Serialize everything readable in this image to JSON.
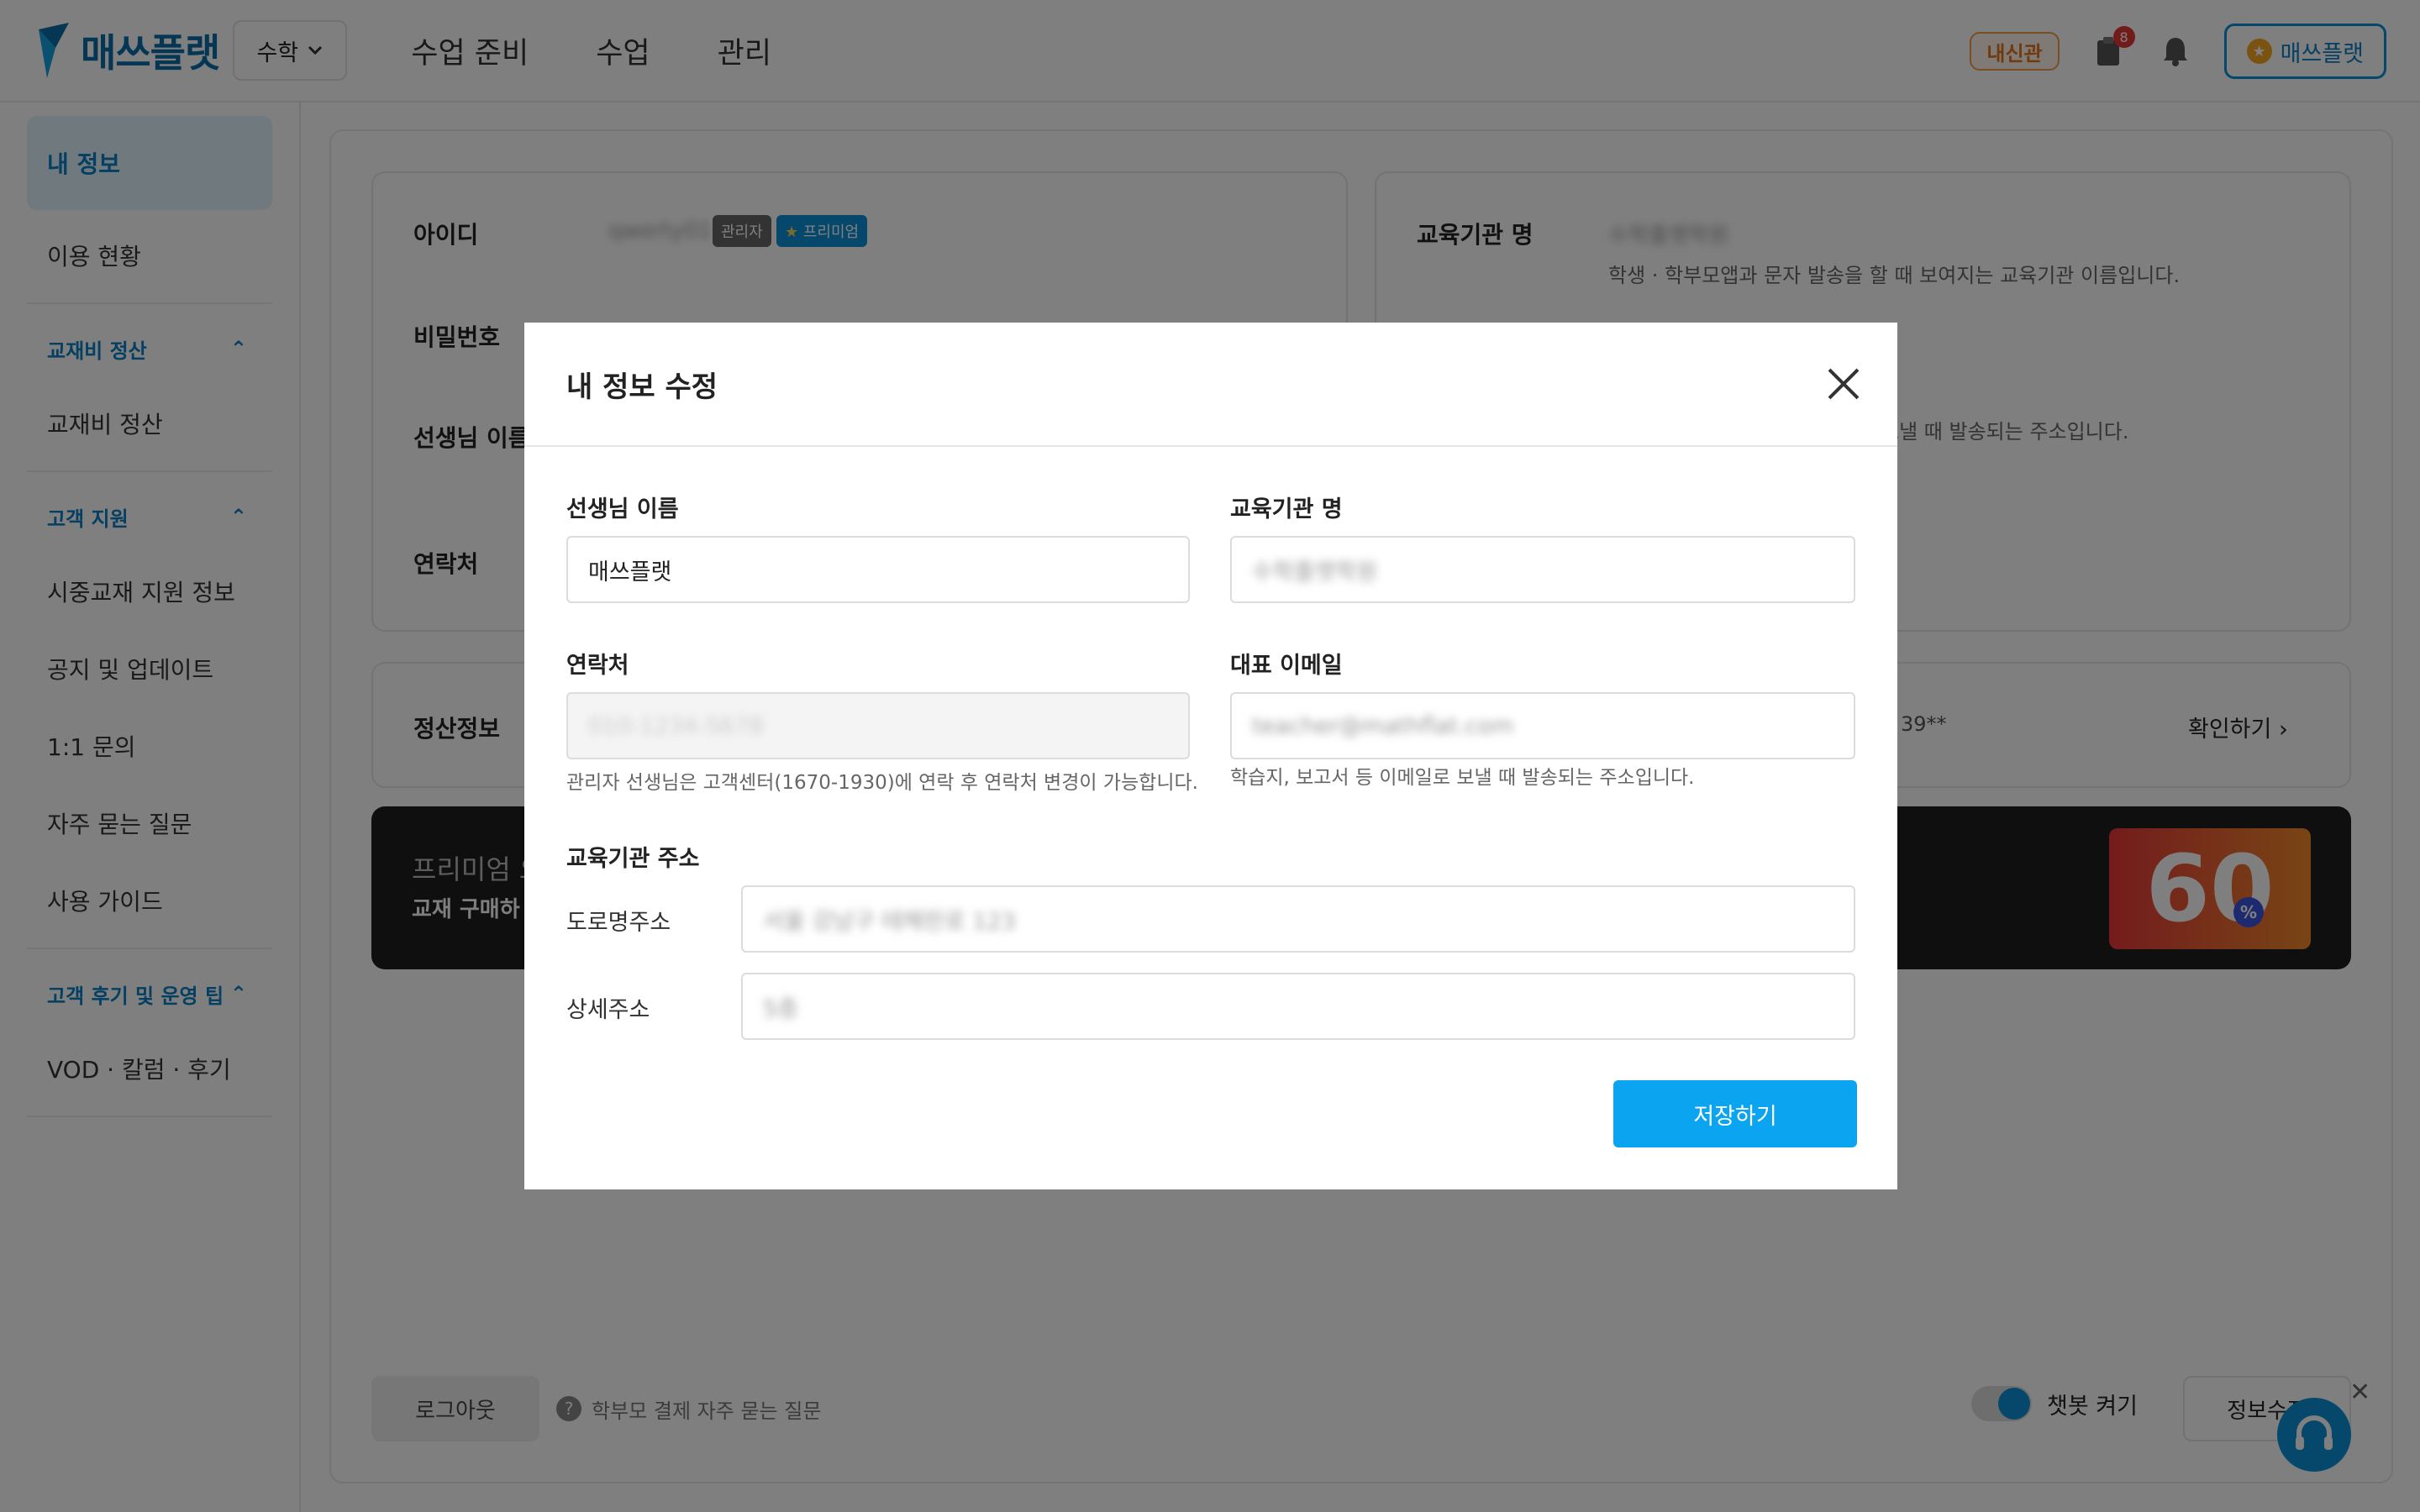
{
  "header": {
    "logo_text": "매쓰플랫",
    "subject": "수학",
    "nav": [
      "수업 준비",
      "수업",
      "관리"
    ],
    "naesin_label": "내신관",
    "notif_count": "8",
    "user_label": "매쓰플랫"
  },
  "sidebar": {
    "my_info": "내 정보",
    "usage": "이용 현황",
    "sections": [
      {
        "title": "교재비 정산",
        "items": [
          "교재비 정산"
        ]
      },
      {
        "title": "고객 지원",
        "items": [
          "시중교재 지원 정보",
          "공지 및 업데이트",
          "1:1 문의",
          "자주 묻는 질문",
          "사용 가이드"
        ]
      },
      {
        "title": "고객 후기 및 운영 팁",
        "items": [
          "VOD · 칼럼 · 후기"
        ]
      }
    ]
  },
  "background": {
    "id_label": "아이디",
    "id_value": "qwerty01",
    "admin_badge": "관리자",
    "premium_badge": "프리미엄",
    "password_label": "비밀번호",
    "teacher_name_label": "선생님 이름",
    "contact_label": "연락처",
    "institution_label": "교육기관 명",
    "institution_value": "수학플랫학원",
    "institution_hint": "학생 · 학부모앱과 문자 발송을 할 때 보여지는 교육기관 이름입니다.",
    "email_hint_partial": "보낼 때 발송되는 주소입니다.",
    "settlement_label": "정산정보",
    "settlement_value": "39**",
    "confirm_link": "확인하기",
    "promo_line1": "프리미엄 요",
    "promo_line2": "교재 구매하",
    "promo_badge": "60",
    "promo_percent": "%",
    "logout": "로그아웃",
    "faq": "학부모 결제 자주 묻는 질문",
    "chatbot": "챗봇 켜기",
    "edit_info": "정보수정"
  },
  "modal": {
    "title": "내 정보 수정",
    "teacher_name_label": "선생님 이름",
    "teacher_name_value": "매쓰플랫",
    "institution_label": "교육기관 명",
    "institution_value": "수학플랫학원",
    "contact_label": "연락처",
    "contact_value": "010-1234-5678",
    "contact_hint": "관리자 선생님은 고객센터(1670-1930)에 연락 후 연락처 변경이 가능합니다.",
    "email_label": "대표 이메일",
    "email_value": "teacher@mathflat.com",
    "email_hint": "학습지, 보고서 등 이메일로 보낼 때 발송되는 주소입니다.",
    "address_label": "교육기관 주소",
    "road_label": "도로명주소",
    "road_value": "서울 강남구 테헤란로 123",
    "detail_label": "상세주소",
    "detail_value": "5층",
    "save_button": "저장하기"
  }
}
